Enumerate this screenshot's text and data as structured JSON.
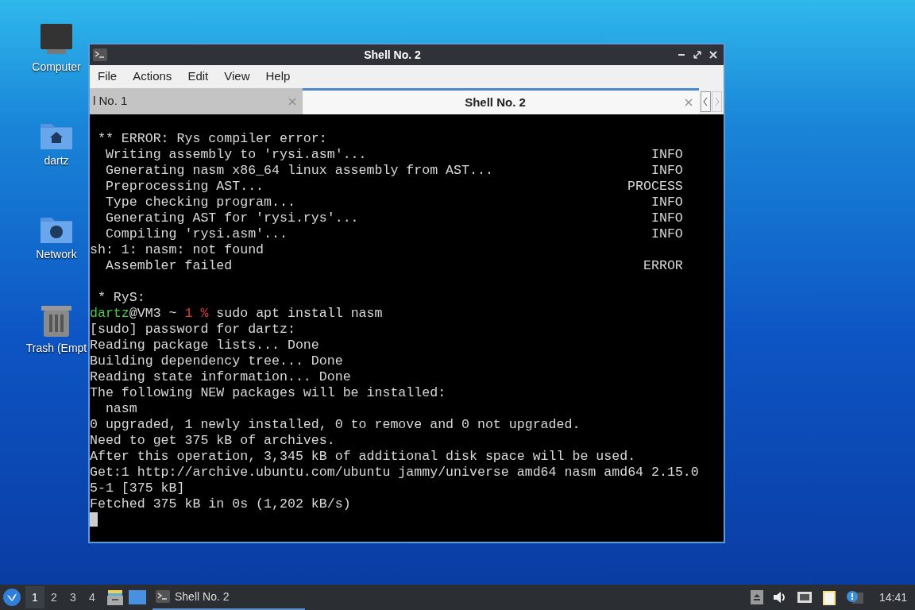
{
  "desktop": {
    "icons": [
      {
        "kind": "computer",
        "label": "Computer"
      },
      {
        "kind": "home",
        "label": "dartz"
      },
      {
        "kind": "network",
        "label": "Network"
      },
      {
        "kind": "trash",
        "label": "Trash (Empt"
      }
    ]
  },
  "window": {
    "title": "Shell No. 2",
    "menu": [
      "File",
      "Actions",
      "Edit",
      "View",
      "Help"
    ],
    "tabs": [
      {
        "label": "l No. 1",
        "selected": false
      },
      {
        "label": "Shell No. 2",
        "selected": true
      }
    ],
    "terminal": {
      "lines": [
        {
          "kind": "blank"
        },
        {
          "kind": "plain",
          "text": " ** ERROR: Rys compiler error:"
        },
        {
          "kind": "status",
          "text": "  Writing assembly to 'rysi.asm'...",
          "status": "INFO"
        },
        {
          "kind": "status",
          "text": "  Generating nasm x86_64 linux assembly from AST...",
          "status": "INFO"
        },
        {
          "kind": "status",
          "text": "  Preprocessing AST...",
          "status": "PROCESS"
        },
        {
          "kind": "status",
          "text": "  Type checking program...",
          "status": "INFO"
        },
        {
          "kind": "status",
          "text": "  Generating AST for 'rysi.rys'...",
          "status": "INFO"
        },
        {
          "kind": "status",
          "text": "  Compiling 'rysi.asm'...",
          "status": "INFO"
        },
        {
          "kind": "plain",
          "text": "sh: 1: nasm: not found"
        },
        {
          "kind": "status",
          "text": "  Assembler failed",
          "status": "ERROR"
        },
        {
          "kind": "blank"
        },
        {
          "kind": "plain",
          "text": " * RyS:"
        },
        {
          "kind": "prompt",
          "user": "dartz",
          "host": "@VM3 ~ ",
          "code": "1 %",
          "text": " sudo apt install nasm"
        },
        {
          "kind": "plain",
          "text": "[sudo] password for dartz:"
        },
        {
          "kind": "plain",
          "text": "Reading package lists... Done"
        },
        {
          "kind": "plain",
          "text": "Building dependency tree... Done"
        },
        {
          "kind": "plain",
          "text": "Reading state information... Done"
        },
        {
          "kind": "plain",
          "text": "The following NEW packages will be installed:"
        },
        {
          "kind": "plain",
          "text": "  nasm"
        },
        {
          "kind": "plain",
          "text": "0 upgraded, 1 newly installed, 0 to remove and 0 not upgraded."
        },
        {
          "kind": "plain",
          "text": "Need to get 375 kB of archives."
        },
        {
          "kind": "plain",
          "text": "After this operation, 3,345 kB of additional disk space will be used."
        },
        {
          "kind": "plain",
          "text": "Get:1 http://archive.ubuntu.com/ubuntu jammy/universe amd64 nasm amd64 2.15.0"
        },
        {
          "kind": "plain",
          "text": "5-1 [375 kB]"
        },
        {
          "kind": "plain",
          "text": "Fetched 375 kB in 0s (1,202 kB/s)"
        },
        {
          "kind": "cursor"
        }
      ]
    }
  },
  "taskbar": {
    "workspaces": [
      {
        "label": "1",
        "selected": true
      },
      {
        "label": "2",
        "selected": false
      },
      {
        "label": "3",
        "selected": false
      },
      {
        "label": "4",
        "selected": false
      }
    ],
    "task": {
      "label": "Shell No. 2"
    },
    "clock": "14:41"
  }
}
